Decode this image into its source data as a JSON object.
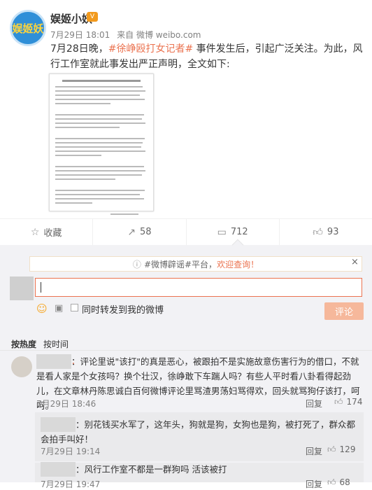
{
  "post": {
    "avatar_text": "娱姬妖",
    "author": "娱姬小妖",
    "vip_badge": "V",
    "time": "7月29日 18:01",
    "source": "来自 微博 weibo.com",
    "text_prefix": "7月28日晚，",
    "hashtag": "#徐峥殴打女记者#",
    "text_suffix": " 事件发生后，引起广泛关注。为此，风行工作室就此事发出严正声明，全文如下:"
  },
  "actions": {
    "favorite": "收藏",
    "repost": "58",
    "comment": "712",
    "like": "93"
  },
  "composer": {
    "tip_tag": "#微博辟谣#平台，",
    "tip_hl": "欢迎查询！",
    "close": "×",
    "repost_label": "同时转发到我的微博",
    "submit": "评论"
  },
  "sort": {
    "hot": "按热度",
    "time": "按时间"
  },
  "comments": [
    {
      "name": "．",
      "text": "：评论里说\"该打\"的真是恶心，被跟拍不是实施故意伤害行为的借口，不就是看人家是个女孩吗？换个壮汉，徐峥敢下车踹人吗？有些人平时看八卦看得起劲儿，在文章林丹陈思诚白百何微博评论里骂渣男荡妇骂得欢，回头就骂狗仔该打，呵呵。",
      "time": "7月29日 18:46",
      "reply": "回复",
      "likes": "174"
    },
    {
      "name": "",
      "text": "：别花钱买水军了，这年头，狗就是狗，女狗也是狗，被打死了，群众都会拍手叫好！",
      "time": "7月29日 19:14",
      "reply": "回复",
      "likes": "129"
    },
    {
      "name": "",
      "text": "：风行工作室不都是一群狗吗 活该被打",
      "time": "7月29日 19:47",
      "reply": "回复",
      "likes": "68"
    }
  ],
  "icons": {
    "favorite": "star-icon",
    "repost": "repost-icon",
    "comment": "comment-icon",
    "like": "thumbs-up-icon"
  }
}
